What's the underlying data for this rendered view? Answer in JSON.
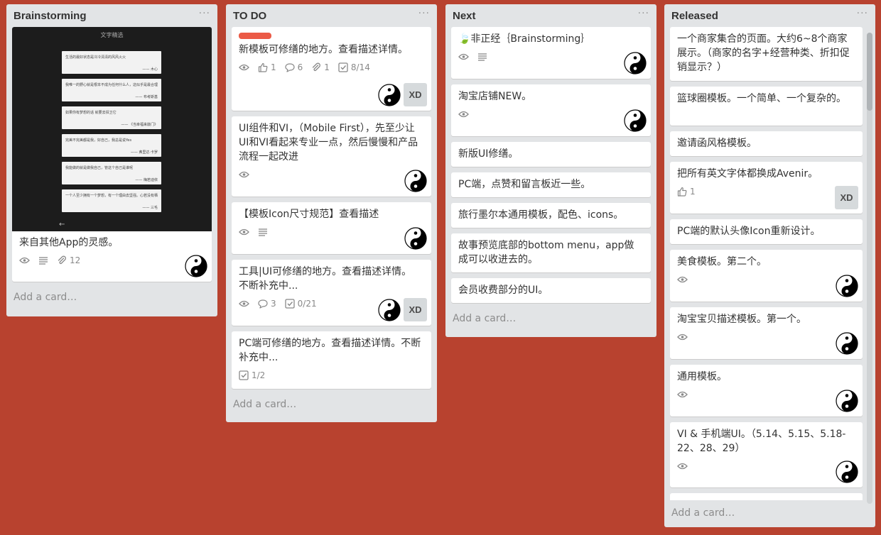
{
  "colors": {
    "board_bg": "#B8422F",
    "list_bg": "#E2E4E6",
    "label_red": "#EB5A46"
  },
  "list_menu_label": "···",
  "add_card_label": "Add a card…",
  "lists": [
    {
      "title": "Brainstorming",
      "cards": [
        {
          "title": "来自其他App的灵感。",
          "cover": {
            "title": "文字精选",
            "quotes": [
              {
                "q": "生活的最好状态是冷冷清清的风风火火",
                "a": "—— 木心"
              },
              {
                "q": "我唯一的野心就是根本不成为任何什么人，这似乎是最合理的一件事",
                "a": "—— 布考斯基"
              },
              {
                "q": "如果你有梦想的话 就要去捍卫它",
                "a": "—— 《当幸福来敲门》"
              },
              {
                "q": "完美不完美都是我，好自己，我总是说Yes",
                "a": "—— 弗里达·卡罗"
              },
              {
                "q": "我能做的就是做我自己，管这个自己是谁呢",
                "a": "—— 梅若迪依"
              },
              {
                "q": "一个人至少拥有一个梦想，有一个理由去坚强。心若没有栖息的地方，到哪里都是流浪",
                "a": "—— 三毛"
              }
            ]
          },
          "badges": [
            {
              "icon": "eye-icon"
            },
            {
              "icon": "description-icon"
            },
            {
              "icon": "paperclip-icon",
              "text": "12"
            }
          ],
          "members": [
            "yin-yang-avatar"
          ]
        }
      ]
    },
    {
      "title": "TO DO",
      "cards": [
        {
          "label": true,
          "title": "新模板可修缮的地方。查看描述详情。",
          "badges": [
            {
              "icon": "eye-icon"
            },
            {
              "icon": "thumbs-up-icon",
              "text": "1"
            },
            {
              "icon": "comment-icon",
              "text": "6"
            },
            {
              "icon": "paperclip-icon",
              "text": "1"
            },
            {
              "icon": "checklist-icon",
              "text": "8/14"
            }
          ],
          "members": [
            "yin-yang-avatar",
            "XD"
          ]
        },
        {
          "title": "UI组件和VI，（Mobile First），先至少让UI和VI看起来专业一点，然后慢慢和产品流程一起改进",
          "badges": [
            {
              "icon": "eye-icon"
            }
          ],
          "members": [
            "yin-yang-avatar"
          ]
        },
        {
          "title": "【模板Icon尺寸规范】查看描述",
          "badges": [
            {
              "icon": "eye-icon"
            },
            {
              "icon": "description-icon"
            }
          ],
          "members": [
            "yin-yang-avatar"
          ]
        },
        {
          "title": "工具|UI可修缮的地方。查看描述详情。不断补充中...",
          "badges": [
            {
              "icon": "eye-icon"
            },
            {
              "icon": "comment-icon",
              "text": "3"
            },
            {
              "icon": "checklist-icon",
              "text": "0/21"
            }
          ],
          "members": [
            "yin-yang-avatar",
            "XD"
          ]
        },
        {
          "title": "PC端可修缮的地方。查看描述详情。不断补充中...",
          "badges": [
            {
              "icon": "checklist-icon",
              "text": "1/2"
            }
          ],
          "members": []
        }
      ]
    },
    {
      "title": "Next",
      "cards": [
        {
          "title": "🍃非正经｛Brainstorming｝",
          "badges": [
            {
              "icon": "eye-icon"
            },
            {
              "icon": "description-icon"
            }
          ],
          "members": [
            "yin-yang-avatar"
          ]
        },
        {
          "title": "淘宝店铺NEW。",
          "badges": [
            {
              "icon": "eye-icon"
            }
          ],
          "members": [
            "yin-yang-avatar"
          ]
        },
        {
          "title": "新版UI修缮。",
          "badges": [],
          "members": []
        },
        {
          "title": "PC端，点赞和留言板近一些。",
          "badges": [],
          "members": []
        },
        {
          "title": "旅行墨尔本通用模板，配色、icons。",
          "badges": [],
          "members": []
        },
        {
          "title": "故事预览底部的bottom menu，app做成可以收进去的。",
          "badges": [],
          "members": []
        },
        {
          "title": "会员收费部分的UI。",
          "badges": [],
          "members": []
        }
      ]
    },
    {
      "title": "Released",
      "cards": [
        {
          "title": "一个商家集合的页面。大约6~8个商家展示。（商家的名字+经营种类、折扣促销显示？）",
          "badges": [],
          "members": []
        },
        {
          "title": "篮球圈模板。一个简单、一个复杂的。",
          "badges": [],
          "members": []
        },
        {
          "title": "邀请函风格模板。",
          "badges": [],
          "members": []
        },
        {
          "title": "把所有英文字体都换成Avenir。",
          "badges": [
            {
              "icon": "thumbs-up-icon",
              "text": "1"
            }
          ],
          "members": [
            "XD"
          ]
        },
        {
          "title": "PC端的默认头像Icon重新设计。",
          "badges": [],
          "members": []
        },
        {
          "title": "美食模板。第二个。",
          "badges": [
            {
              "icon": "eye-icon"
            }
          ],
          "members": [
            "yin-yang-avatar"
          ]
        },
        {
          "title": "淘宝宝贝描述模板。第一个。",
          "badges": [
            {
              "icon": "eye-icon"
            }
          ],
          "members": [
            "yin-yang-avatar"
          ]
        },
        {
          "title": "通用模板。",
          "badges": [
            {
              "icon": "eye-icon"
            }
          ],
          "members": [
            "yin-yang-avatar"
          ]
        },
        {
          "title": "VI & 手机端UI。（5.14、5.15、5.18-22、28、29）",
          "badges": [
            {
              "icon": "eye-icon"
            }
          ],
          "members": [
            "yin-yang-avatar"
          ]
        }
      ]
    }
  ]
}
